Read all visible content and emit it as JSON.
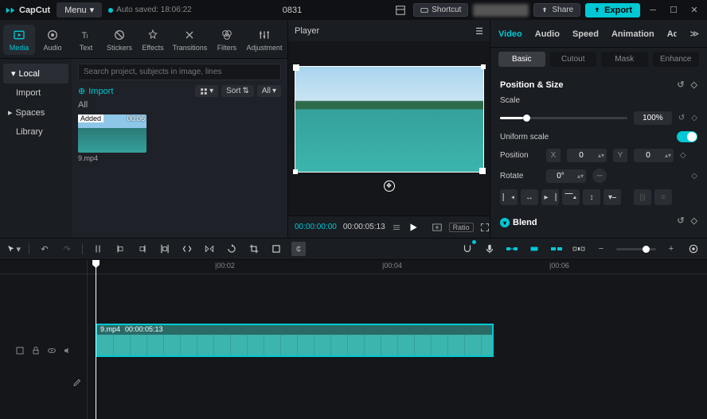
{
  "app": {
    "name": "CapCut",
    "menu_label": "Menu",
    "autosave": "Auto saved: 18:06:22",
    "title": "0831"
  },
  "titlebar": {
    "shortcut": "Shortcut",
    "share": "Share",
    "export": "Export"
  },
  "media_tabs": [
    {
      "label": "Media",
      "icon": "media-icon"
    },
    {
      "label": "Audio",
      "icon": "audio-icon"
    },
    {
      "label": "Text",
      "icon": "text-icon"
    },
    {
      "label": "Stickers",
      "icon": "stickers-icon"
    },
    {
      "label": "Effects",
      "icon": "effects-icon"
    },
    {
      "label": "Transitions",
      "icon": "transitions-icon"
    },
    {
      "label": "Filters",
      "icon": "filters-icon"
    },
    {
      "label": "Adjustment",
      "icon": "adjustment-icon"
    }
  ],
  "sidebar": [
    {
      "label": "Local"
    },
    {
      "label": "Import"
    },
    {
      "label": "Spaces"
    },
    {
      "label": "Library"
    }
  ],
  "media": {
    "search_placeholder": "Search project, subjects in image, lines",
    "import_label": "Import",
    "sort_label": "Sort",
    "all_label": "All",
    "filter_label": "All",
    "clip": {
      "badge": "Added",
      "time": "00:06",
      "name": "9.mp4"
    }
  },
  "player": {
    "title": "Player",
    "current": "00:00:00:00",
    "duration": "00:00:05:13",
    "ratio": "Ratio"
  },
  "inspector": {
    "tabs": [
      "Video",
      "Audio",
      "Speed",
      "Animation",
      "Adjust"
    ],
    "subtabs": [
      "Basic",
      "Cutout",
      "Mask",
      "Enhance"
    ],
    "section_pos": "Position & Size",
    "scale_label": "Scale",
    "scale_value": "100%",
    "uniform_label": "Uniform scale",
    "position_label": "Position",
    "pos_x": "0",
    "pos_y": "0",
    "rotate_label": "Rotate",
    "rotate_value": "0°",
    "blend_label": "Blend"
  },
  "timeline": {
    "ticks": [
      "|00:02",
      "|00:04",
      "|00:06"
    ],
    "clip_name": "9.mp4",
    "clip_dur": "00:00:05:13"
  }
}
